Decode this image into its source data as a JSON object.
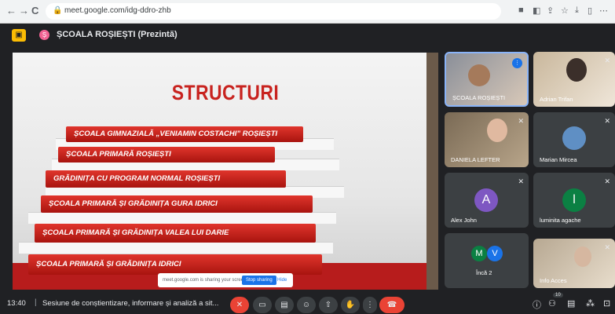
{
  "browser": {
    "url": "meet.google.com/idg-ddro-zhb",
    "nav_back": "←",
    "nav_forward": "→",
    "nav_reload": "C",
    "lock_glyph": "🔒"
  },
  "meeting": {
    "present_glyph": "▣",
    "badge_letter": "Ș",
    "title": "ȘCOALA ROȘIEȘTI (Prezintă)"
  },
  "slide": {
    "title": "STRUCTURI",
    "steps": [
      "ȘCOALA GIMNAZIALĂ „VENIAMIN COSTACHI” ROȘIEȘTI",
      "ȘCOALA PRIMARĂ ROȘIEȘTI",
      "GRĂDINIȚA CU PROGRAM NORMAL ROȘIEȘTI",
      "ȘCOALA PRIMARĂ ȘI GRĂDINIȚA GURA IDRICI",
      "ȘCOALA PRIMARĂ ȘI GRĂDINIȚA VALEA LUI DARIE",
      "ȘCOALA PRIMARĂ ȘI GRĂDINIȚA IDRICI"
    ]
  },
  "sharing": {
    "message": "meet.google.com is sharing your screen.",
    "stop_label": "Stop sharing",
    "hide_label": "Hide"
  },
  "participants": [
    {
      "name": "ȘCOALA ROȘIEȘTI",
      "kind": "video"
    },
    {
      "name": "Adrian Trifan",
      "kind": "video"
    },
    {
      "name": "DANIELA LEFTER",
      "kind": "video"
    },
    {
      "name": "Marian Mircea",
      "kind": "video"
    },
    {
      "name": "Alex John",
      "kind": "avatar",
      "initial": "A",
      "color": "#7e57c2"
    },
    {
      "name": "luminita agache",
      "kind": "avatar",
      "initial": "l",
      "color": "#0b8043"
    },
    {
      "name": "Încă 2",
      "kind": "more",
      "initials": [
        "M",
        "V"
      ],
      "colors": [
        "#0b8043",
        "#1a73e8"
      ]
    },
    {
      "name": "Info Acces",
      "kind": "video"
    }
  ],
  "footer": {
    "time": "13:40",
    "separator": "|",
    "meeting_name": "Sesiune de conștientizare, informare și analiză a sit...",
    "participant_count": "10"
  },
  "colors": {
    "accent_red": "#ea4335",
    "slide_red": "#c8231f",
    "dark_bg": "#202124"
  }
}
